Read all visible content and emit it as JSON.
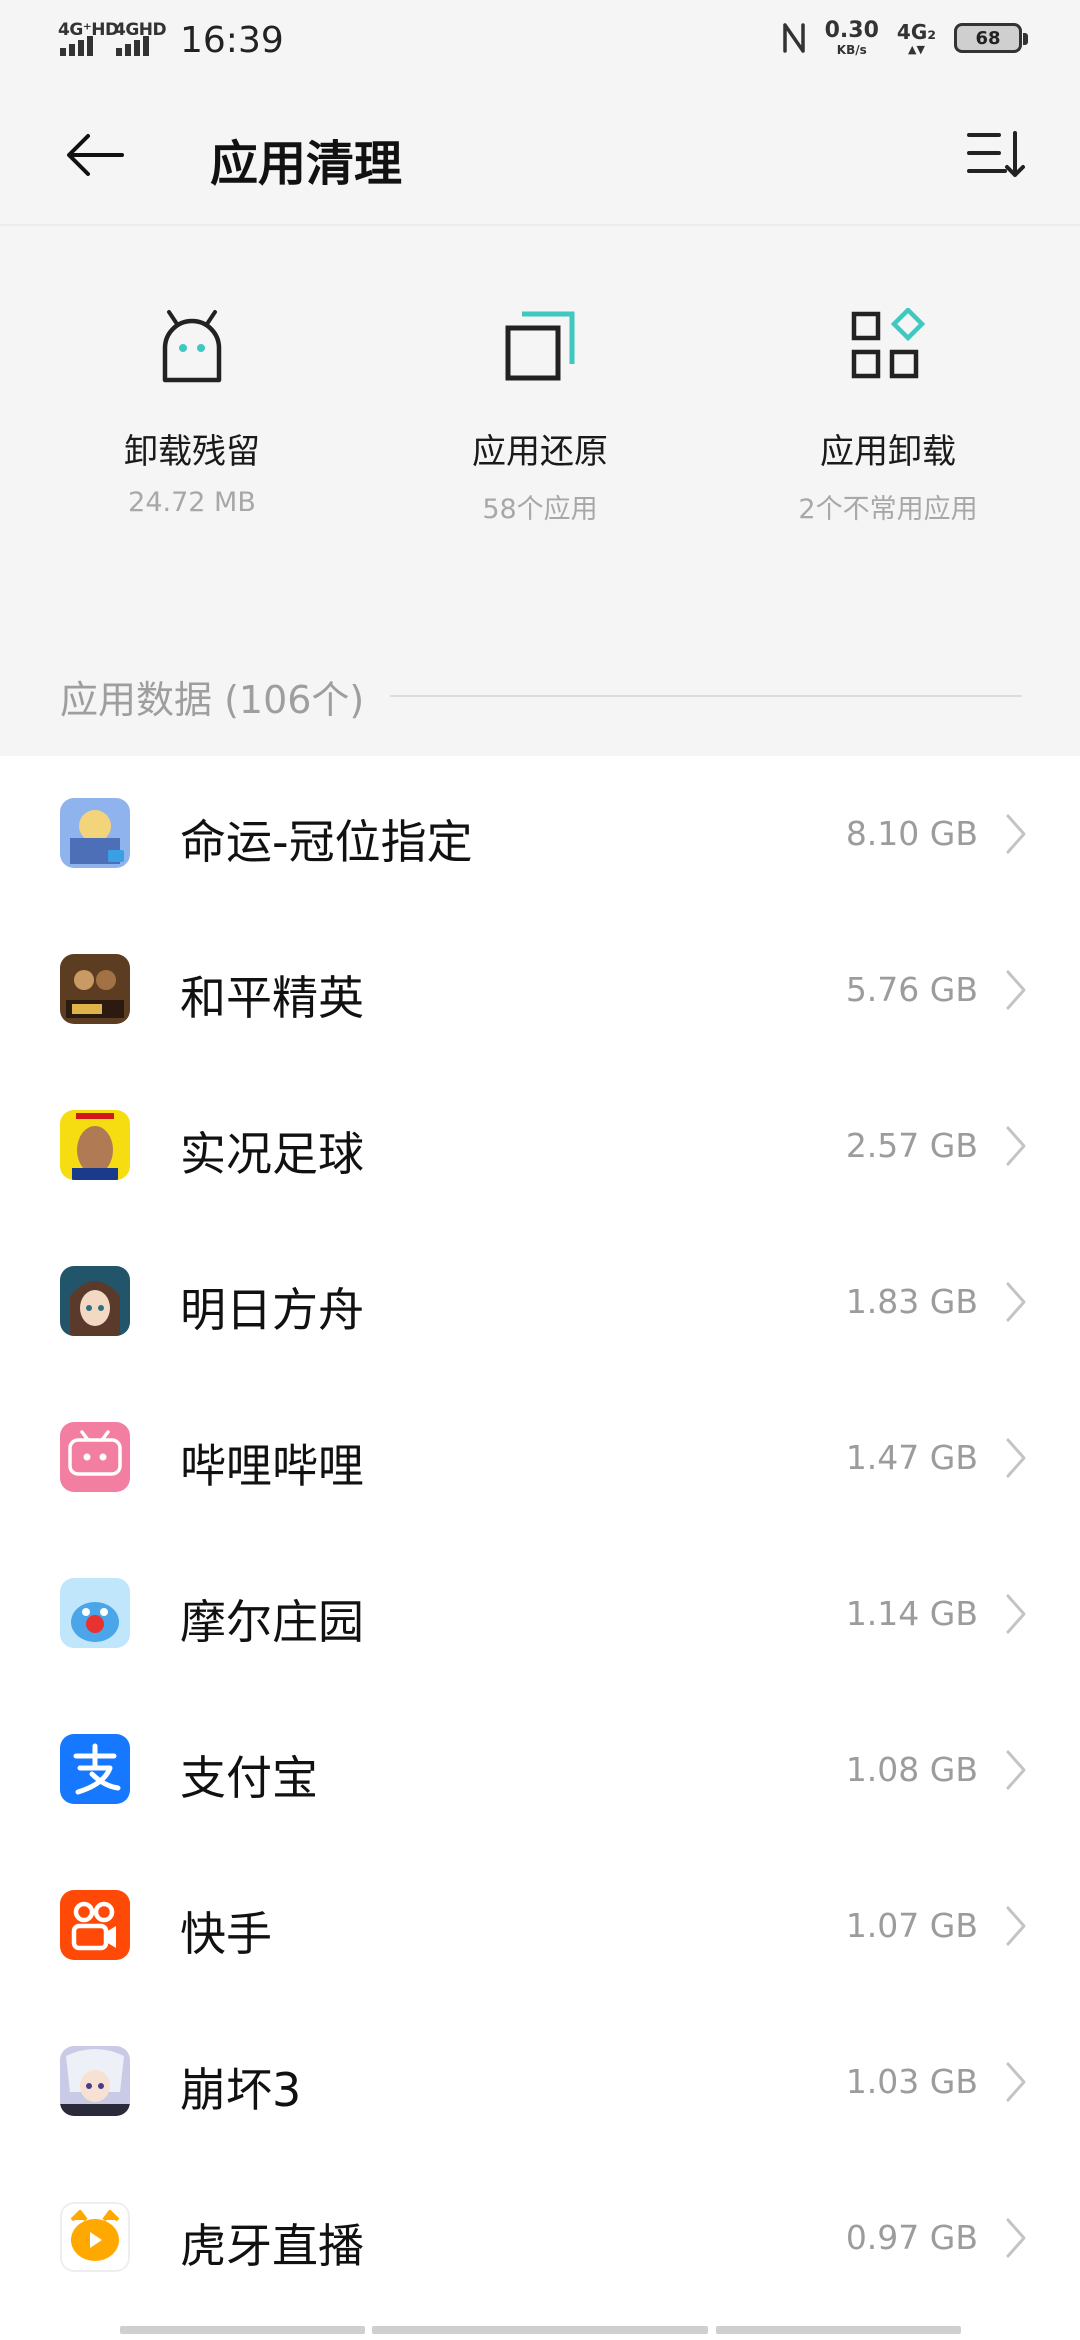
{
  "status_bar": {
    "sim1": "4G⁺HD",
    "sim2": "4GHD",
    "time": "16:39",
    "net_speed": "0.30",
    "net_speed_unit": "KB/s",
    "net_type": "4G₂",
    "battery": "68"
  },
  "header": {
    "title": "应用清理",
    "back_icon": "arrow-left-icon",
    "sort_icon": "sort-icon"
  },
  "tools": [
    {
      "name": "卸载残留",
      "sub": "24.72 MB",
      "icon": "android-icon",
      "accent": "#3ec8c0"
    },
    {
      "name": "应用还原",
      "sub": "58个应用",
      "icon": "restore-icon",
      "accent": "#3ec8c0"
    },
    {
      "name": "应用卸载",
      "sub": "2个不常用应用",
      "icon": "apps-grid-icon",
      "accent": "#3ec8c0"
    }
  ],
  "section": {
    "label": "应用数据 (106个)"
  },
  "apps": [
    {
      "name": "命运-冠位指定",
      "size": "8.10 GB",
      "icon_color": "#7fa8e8"
    },
    {
      "name": "和平精英",
      "size": "5.76 GB",
      "icon_color": "#6b4a2a"
    },
    {
      "name": "实况足球",
      "size": "2.57 GB",
      "icon_color": "#f5dd12"
    },
    {
      "name": "明日方舟",
      "size": "1.83 GB",
      "icon_color": "#2b6f82"
    },
    {
      "name": "哔哩哔哩",
      "size": "1.47 GB",
      "icon_color": "#f27ea1"
    },
    {
      "name": "摩尔庄园",
      "size": "1.14 GB",
      "icon_color": "#7cc6f0"
    },
    {
      "name": "支付宝",
      "size": "1.08 GB",
      "icon_color": "#1677ff"
    },
    {
      "name": "快手",
      "size": "1.07 GB",
      "icon_color": "#ff4906"
    },
    {
      "name": "崩坏3",
      "size": "1.03 GB",
      "icon_color": "#b7b9d8"
    },
    {
      "name": "虎牙直播",
      "size": "0.97 GB",
      "icon_color": "#ffa800"
    }
  ]
}
